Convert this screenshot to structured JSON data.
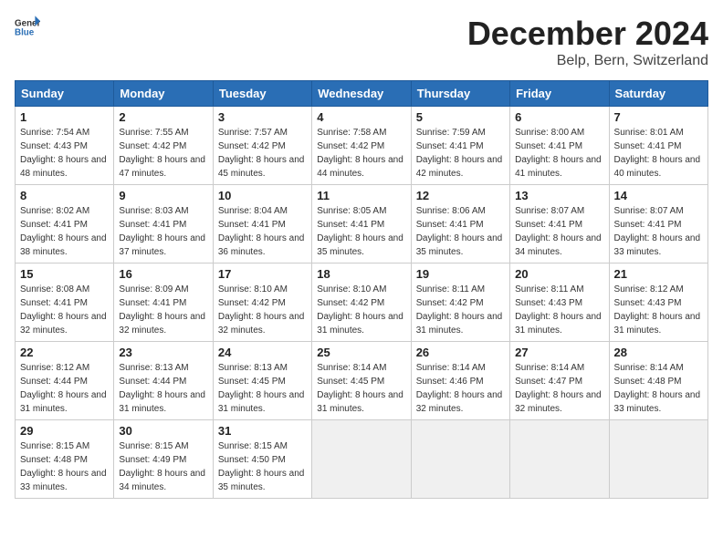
{
  "header": {
    "logo_general": "General",
    "logo_blue": "Blue",
    "title": "December 2024",
    "location": "Belp, Bern, Switzerland"
  },
  "days_of_week": [
    "Sunday",
    "Monday",
    "Tuesday",
    "Wednesday",
    "Thursday",
    "Friday",
    "Saturday"
  ],
  "weeks": [
    [
      {
        "day": "1",
        "sunrise": "7:54 AM",
        "sunset": "4:43 PM",
        "daylight": "8 hours and 48 minutes."
      },
      {
        "day": "2",
        "sunrise": "7:55 AM",
        "sunset": "4:42 PM",
        "daylight": "8 hours and 47 minutes."
      },
      {
        "day": "3",
        "sunrise": "7:57 AM",
        "sunset": "4:42 PM",
        "daylight": "8 hours and 45 minutes."
      },
      {
        "day": "4",
        "sunrise": "7:58 AM",
        "sunset": "4:42 PM",
        "daylight": "8 hours and 44 minutes."
      },
      {
        "day": "5",
        "sunrise": "7:59 AM",
        "sunset": "4:41 PM",
        "daylight": "8 hours and 42 minutes."
      },
      {
        "day": "6",
        "sunrise": "8:00 AM",
        "sunset": "4:41 PM",
        "daylight": "8 hours and 41 minutes."
      },
      {
        "day": "7",
        "sunrise": "8:01 AM",
        "sunset": "4:41 PM",
        "daylight": "8 hours and 40 minutes."
      }
    ],
    [
      {
        "day": "8",
        "sunrise": "8:02 AM",
        "sunset": "4:41 PM",
        "daylight": "8 hours and 38 minutes."
      },
      {
        "day": "9",
        "sunrise": "8:03 AM",
        "sunset": "4:41 PM",
        "daylight": "8 hours and 37 minutes."
      },
      {
        "day": "10",
        "sunrise": "8:04 AM",
        "sunset": "4:41 PM",
        "daylight": "8 hours and 36 minutes."
      },
      {
        "day": "11",
        "sunrise": "8:05 AM",
        "sunset": "4:41 PM",
        "daylight": "8 hours and 35 minutes."
      },
      {
        "day": "12",
        "sunrise": "8:06 AM",
        "sunset": "4:41 PM",
        "daylight": "8 hours and 35 minutes."
      },
      {
        "day": "13",
        "sunrise": "8:07 AM",
        "sunset": "4:41 PM",
        "daylight": "8 hours and 34 minutes."
      },
      {
        "day": "14",
        "sunrise": "8:07 AM",
        "sunset": "4:41 PM",
        "daylight": "8 hours and 33 minutes."
      }
    ],
    [
      {
        "day": "15",
        "sunrise": "8:08 AM",
        "sunset": "4:41 PM",
        "daylight": "8 hours and 32 minutes."
      },
      {
        "day": "16",
        "sunrise": "8:09 AM",
        "sunset": "4:41 PM",
        "daylight": "8 hours and 32 minutes."
      },
      {
        "day": "17",
        "sunrise": "8:10 AM",
        "sunset": "4:42 PM",
        "daylight": "8 hours and 32 minutes."
      },
      {
        "day": "18",
        "sunrise": "8:10 AM",
        "sunset": "4:42 PM",
        "daylight": "8 hours and 31 minutes."
      },
      {
        "day": "19",
        "sunrise": "8:11 AM",
        "sunset": "4:42 PM",
        "daylight": "8 hours and 31 minutes."
      },
      {
        "day": "20",
        "sunrise": "8:11 AM",
        "sunset": "4:43 PM",
        "daylight": "8 hours and 31 minutes."
      },
      {
        "day": "21",
        "sunrise": "8:12 AM",
        "sunset": "4:43 PM",
        "daylight": "8 hours and 31 minutes."
      }
    ],
    [
      {
        "day": "22",
        "sunrise": "8:12 AM",
        "sunset": "4:44 PM",
        "daylight": "8 hours and 31 minutes."
      },
      {
        "day": "23",
        "sunrise": "8:13 AM",
        "sunset": "4:44 PM",
        "daylight": "8 hours and 31 minutes."
      },
      {
        "day": "24",
        "sunrise": "8:13 AM",
        "sunset": "4:45 PM",
        "daylight": "8 hours and 31 minutes."
      },
      {
        "day": "25",
        "sunrise": "8:14 AM",
        "sunset": "4:45 PM",
        "daylight": "8 hours and 31 minutes."
      },
      {
        "day": "26",
        "sunrise": "8:14 AM",
        "sunset": "4:46 PM",
        "daylight": "8 hours and 32 minutes."
      },
      {
        "day": "27",
        "sunrise": "8:14 AM",
        "sunset": "4:47 PM",
        "daylight": "8 hours and 32 minutes."
      },
      {
        "day": "28",
        "sunrise": "8:14 AM",
        "sunset": "4:48 PM",
        "daylight": "8 hours and 33 minutes."
      }
    ],
    [
      {
        "day": "29",
        "sunrise": "8:15 AM",
        "sunset": "4:48 PM",
        "daylight": "8 hours and 33 minutes."
      },
      {
        "day": "30",
        "sunrise": "8:15 AM",
        "sunset": "4:49 PM",
        "daylight": "8 hours and 34 minutes."
      },
      {
        "day": "31",
        "sunrise": "8:15 AM",
        "sunset": "4:50 PM",
        "daylight": "8 hours and 35 minutes."
      },
      null,
      null,
      null,
      null
    ]
  ]
}
